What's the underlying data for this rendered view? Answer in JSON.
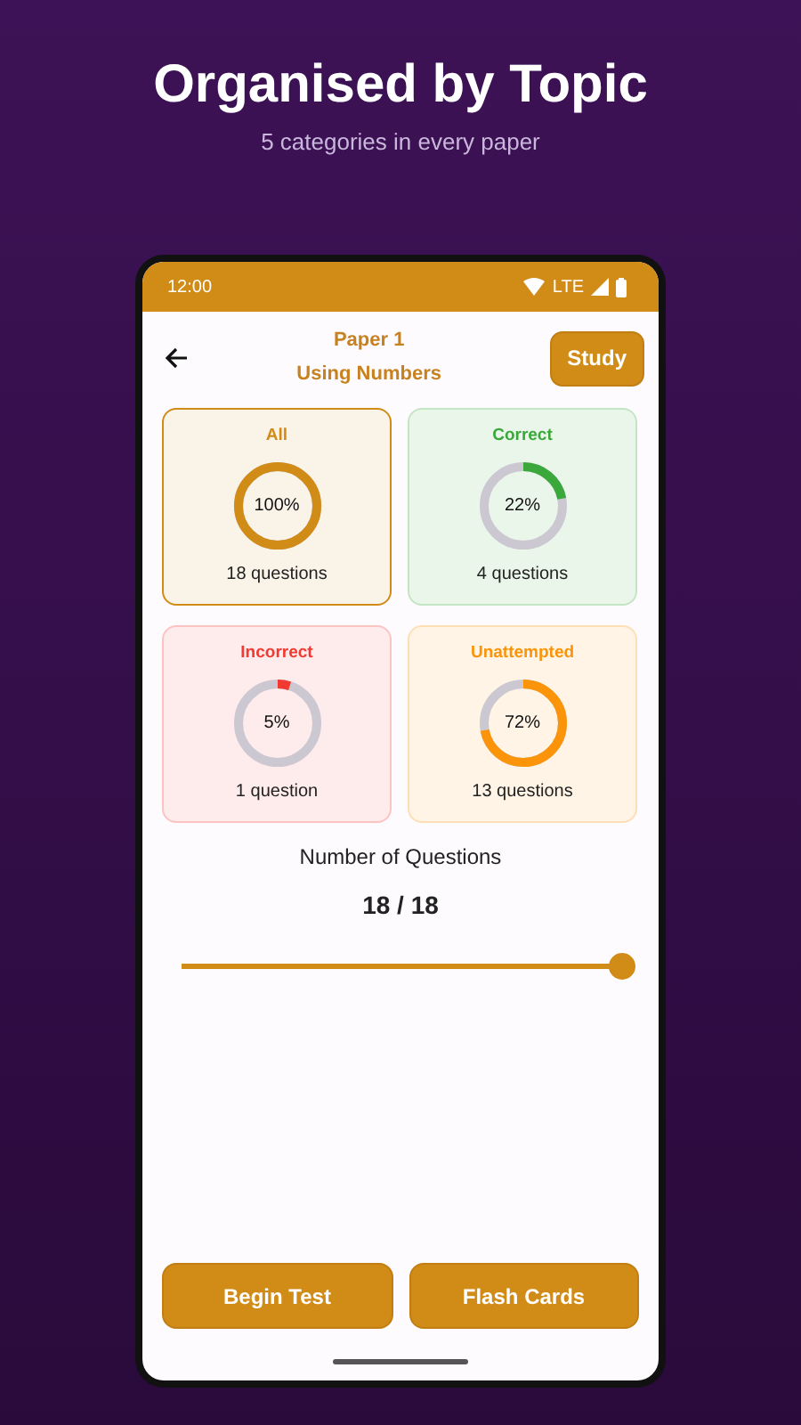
{
  "headline": {
    "title": "Organised by Topic",
    "subtitle": "5 categories in every paper"
  },
  "status_bar": {
    "time": "12:00",
    "network": "LTE"
  },
  "header": {
    "title": "Paper 1",
    "subtitle": "Using Numbers",
    "action": "Study"
  },
  "categories": [
    {
      "label": "All",
      "percent": "100%",
      "count": "18 questions",
      "level": 1,
      "color": "#d18b17",
      "selected": true
    },
    {
      "label": "Correct",
      "percent": "22%",
      "count": "4 questions",
      "level": 0.22,
      "color": "#3aa83a",
      "selected": false
    },
    {
      "label": "Incorrect",
      "percent": "5%",
      "count": "1 question",
      "level": 0.05,
      "color": "#f03a32",
      "selected": false
    },
    {
      "label": "Unattempted",
      "percent": "72%",
      "count": "13 questions",
      "level": 0.72,
      "color": "#fb9408",
      "selected": false
    }
  ],
  "question_count": {
    "label": "Number of Questions",
    "value": "18 / 18",
    "level": 1
  },
  "buttons": [
    "Begin Test",
    "Flash Cards"
  ]
}
